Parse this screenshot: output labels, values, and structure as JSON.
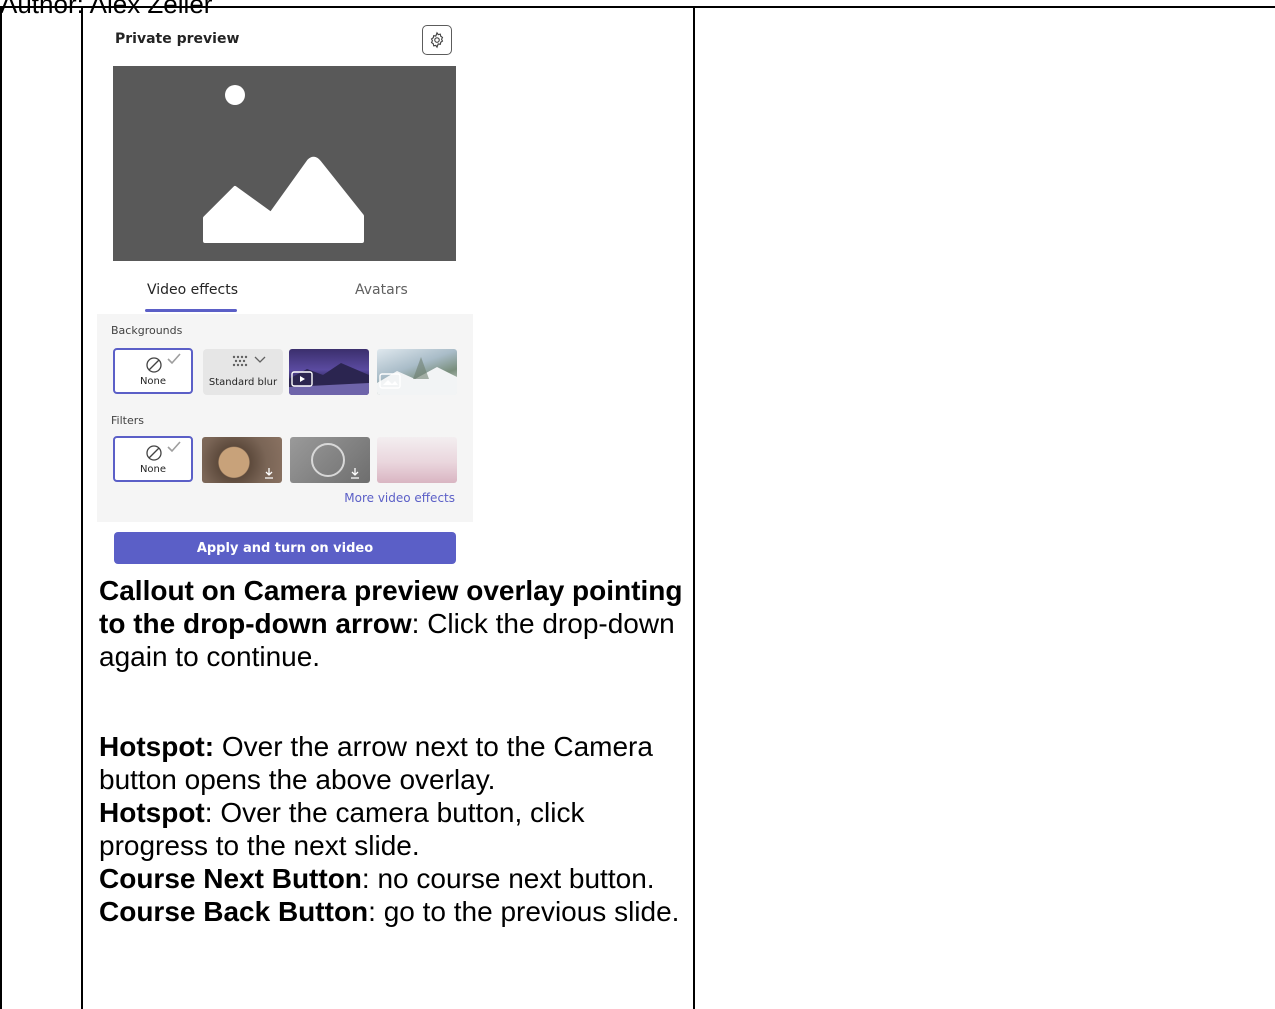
{
  "header_text": "Author: Alex Zelier",
  "panel": {
    "title": "Private preview",
    "settings_icon": "gear-icon",
    "preview_icon": "image-placeholder-icon",
    "tabs": [
      {
        "label": "Video effects",
        "active": true
      },
      {
        "label": "Avatars",
        "active": false
      }
    ],
    "backgrounds": {
      "label": "Backgrounds",
      "items": [
        {
          "label": "None",
          "selected": true
        },
        {
          "label": "Standard blur",
          "selected": false
        },
        {
          "label": "",
          "icon": "video-icon"
        },
        {
          "label": "",
          "icon": "image-icon"
        }
      ]
    },
    "filters": {
      "label": "Filters",
      "items": [
        {
          "label": "None",
          "selected": true
        },
        {
          "label": "",
          "icon": "download-icon"
        },
        {
          "label": "",
          "icon": "download-icon"
        },
        {
          "label": ""
        }
      ]
    },
    "more_link": "More video effects",
    "apply_button": "Apply and turn on video",
    "accent_color": "#5b5fc7"
  },
  "instructions": {
    "callout_bold": "Callout on Camera preview overlay pointing to the drop-down arrow",
    "callout_text": ": Click the drop-down again to continue.",
    "hotspot1_bold": "Hotspot:",
    "hotspot1_text": " Over the arrow next to the Camera button opens the above overlay.",
    "hotspot2_bold": "Hotspot",
    "hotspot2_text": ": Over the camera button, click progress to the next slide.",
    "next_bold": "Course Next Button",
    "next_text": ": no course next button.",
    "back_bold": "Course Back Button",
    "back_text": ": go to the previous slide."
  }
}
